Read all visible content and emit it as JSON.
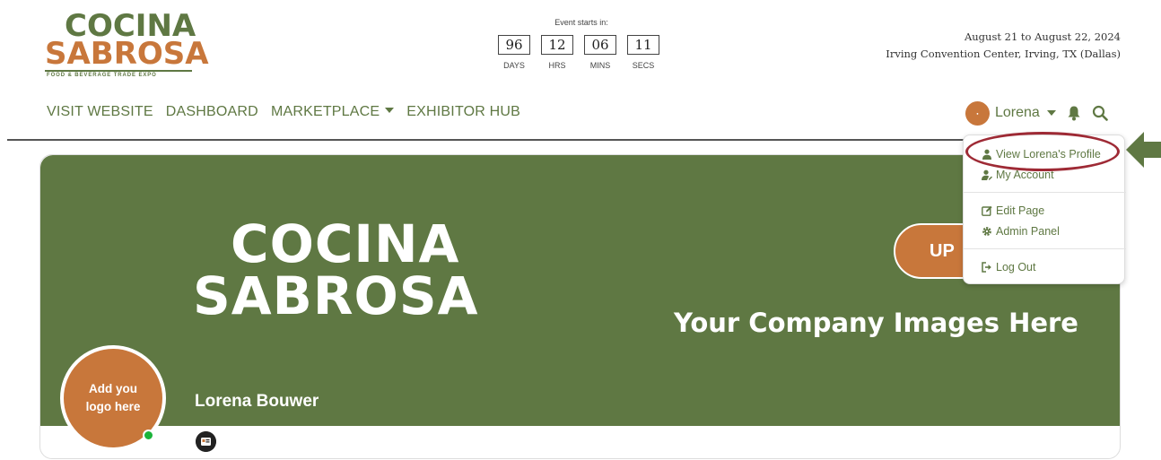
{
  "brand": {
    "line1": "COCINA",
    "line2": "SABROSA",
    "tagline": "FOOD & BEVERAGE TRADE EXPO",
    "green": "#5f7843",
    "orange": "#c8773b"
  },
  "countdown": {
    "title": "Event starts in:",
    "units": [
      {
        "value": "96",
        "label": "DAYS"
      },
      {
        "value": "12",
        "label": "HRS"
      },
      {
        "value": "06",
        "label": "MINS"
      },
      {
        "value": "11",
        "label": "SECS"
      }
    ]
  },
  "event": {
    "dates": "August 21 to August 22, 2024",
    "location": "Irving Convention Center, Irving, TX (Dallas)"
  },
  "nav": {
    "items": [
      "VISIT WEBSITE",
      "DASHBOARD",
      "MARKETPLACE",
      "EXHIBITOR HUB"
    ]
  },
  "user": {
    "name": "Lorena",
    "avatar_icon": "user-avatar",
    "bell_icon": "bell-icon",
    "search_icon": "search-icon"
  },
  "dropdown": {
    "items": [
      {
        "label": "View Lorena's Profile",
        "icon": "user-icon"
      },
      {
        "label": "My Account",
        "icon": "user-edit-icon"
      },
      {
        "label": "Edit Page",
        "icon": "edit-icon"
      },
      {
        "label": "Admin Panel",
        "icon": "gear-icon"
      },
      {
        "label": "Log Out",
        "icon": "logout-icon"
      }
    ],
    "highlight_color": "#9e2a35"
  },
  "profile": {
    "banner_line1": "COCINA",
    "banner_line2": "SABROSA",
    "banner_caption": "Your Company Images Here",
    "upload_label": "UP",
    "logo_placeholder_line1": "Add you",
    "logo_placeholder_line2": "logo here",
    "name": "Lorena Bouwer",
    "status_color": "#1bb33a"
  }
}
